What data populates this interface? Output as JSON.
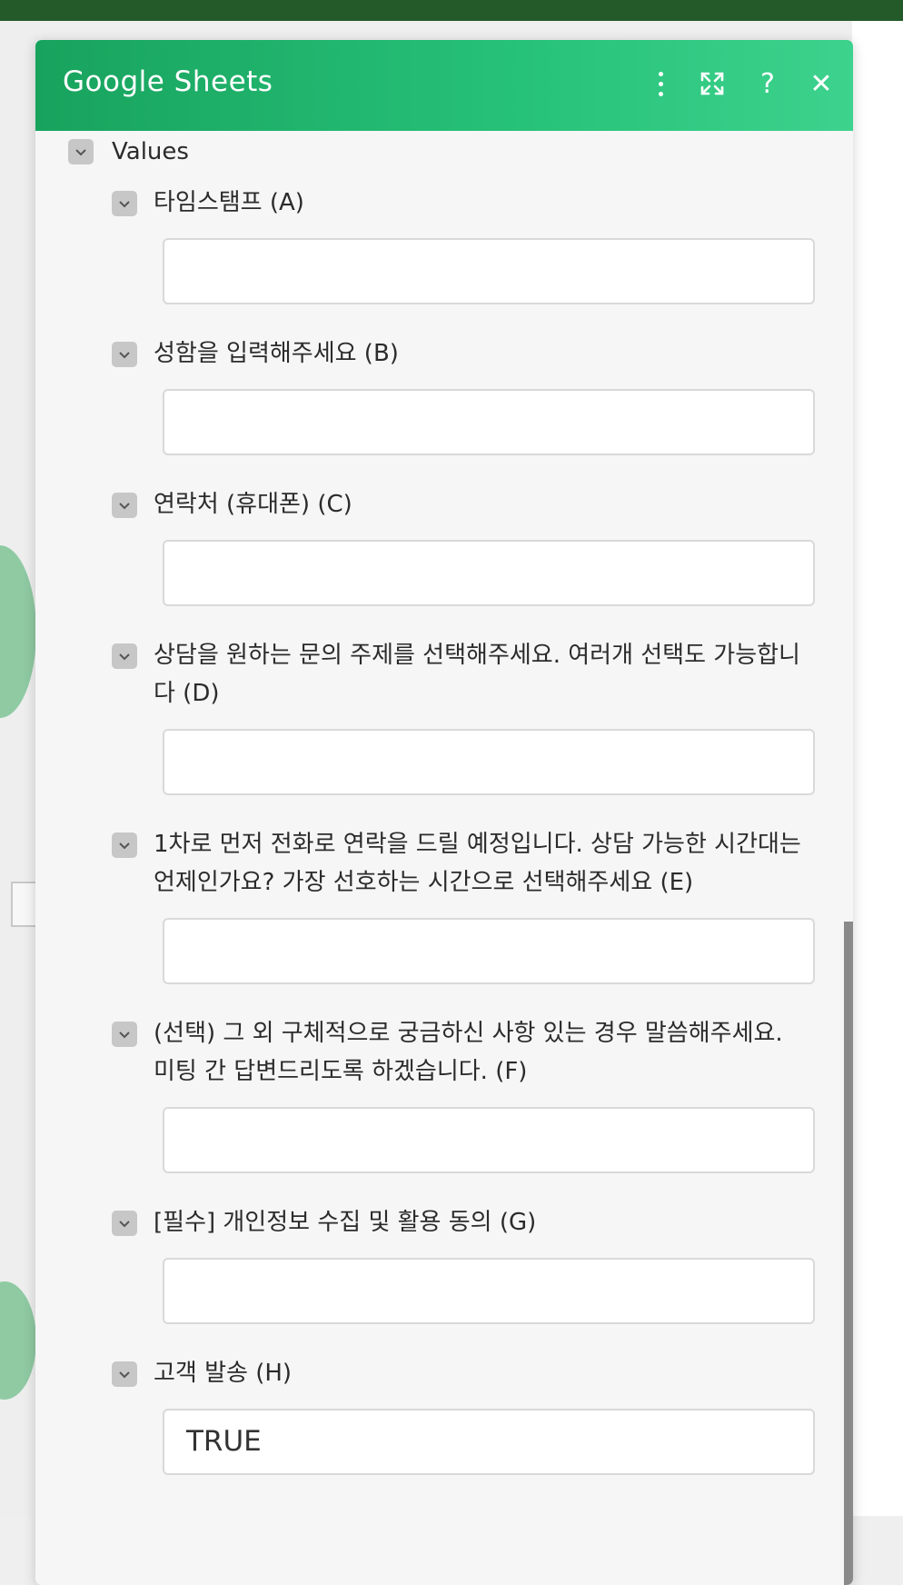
{
  "modal": {
    "title": "Google Sheets",
    "header_icons": [
      "more-vertical-icon",
      "expand-icon",
      "help-icon",
      "close-icon"
    ],
    "help_glyph": "?",
    "close_glyph": "✕"
  },
  "values_section": {
    "label": "Values"
  },
  "fields": [
    {
      "label": "타임스탬프 (A)",
      "value": ""
    },
    {
      "label": "성함을 입력해주세요 (B)",
      "value": ""
    },
    {
      "label": "연락처 (휴대폰) (C)",
      "value": ""
    },
    {
      "label_line1": "상담을 원하는 문의 주제를 선택해주세요. 여러개 선택도 가능합니",
      "label_line2": "다 (D)",
      "value": ""
    },
    {
      "label_line1": "1차로 먼저 전화로 연락을 드릴 예정입니다. 상담 가능한 시간대는",
      "label_line2": "언제인가요? 가장 선호하는 시간으로 선택해주세요 (E)",
      "value": ""
    },
    {
      "label_line1": "(선택) 그 외 구체적으로 궁금하신 사항 있는 경우 말씀해주세요.",
      "label_line2": "미팅 간 답변드리도록 하겠습니다. (F)",
      "value": ""
    },
    {
      "label": "[필수] 개인정보 수집 및 활용 동의 (G)",
      "value": ""
    },
    {
      "label": "고객 발송 (H)",
      "value": "TRUE"
    }
  ],
  "colors": {
    "header_start": "#18a35d",
    "header_end": "#3dd28d",
    "checkbox": "#c7c7c7",
    "topbar": "#245a2a"
  }
}
